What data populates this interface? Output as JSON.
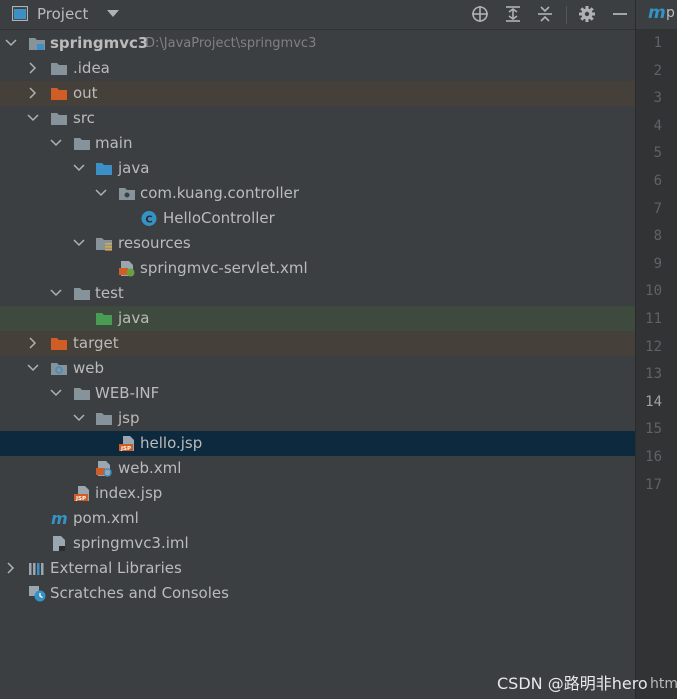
{
  "toolbar": {
    "title": "Project",
    "icons": [
      "project-view-icon",
      "dropdown-caret-icon",
      "locate-icon",
      "expand-all-icon",
      "collapse-all-icon",
      "settings-icon",
      "hide-icon"
    ]
  },
  "tree": {
    "rows": [
      {
        "label": "springmvc3",
        "path": "D:\\JavaProject\\springmvc3",
        "icon": "module-folder-icon"
      },
      {
        "label": ".idea",
        "icon": "folder-icon"
      },
      {
        "label": "out",
        "icon": "excluded-folder-icon"
      },
      {
        "label": "src",
        "icon": "folder-icon"
      },
      {
        "label": "main",
        "icon": "folder-icon"
      },
      {
        "label": "java",
        "icon": "source-folder-icon"
      },
      {
        "label": "com.kuang.controller",
        "icon": "package-icon"
      },
      {
        "label": "HelloController",
        "icon": "class-icon"
      },
      {
        "label": "resources",
        "icon": "resources-folder-icon"
      },
      {
        "label": "springmvc-servlet.xml",
        "icon": "spring-xml-icon"
      },
      {
        "label": "test",
        "icon": "folder-icon"
      },
      {
        "label": "java",
        "icon": "test-source-folder-icon"
      },
      {
        "label": "target",
        "icon": "excluded-folder-icon"
      },
      {
        "label": "web",
        "icon": "web-folder-icon"
      },
      {
        "label": "WEB-INF",
        "icon": "folder-icon"
      },
      {
        "label": "jsp",
        "icon": "folder-icon"
      },
      {
        "label": "hello.jsp",
        "icon": "jsp-file-icon"
      },
      {
        "label": "web.xml",
        "icon": "web-xml-icon"
      },
      {
        "label": "index.jsp",
        "icon": "jsp-file-icon"
      },
      {
        "label": "pom.xml",
        "icon": "maven-icon"
      },
      {
        "label": "springmvc3.iml",
        "icon": "iml-file-icon"
      },
      {
        "label": "External Libraries",
        "icon": "libraries-icon"
      },
      {
        "label": "Scratches and Consoles",
        "icon": "scratches-icon"
      }
    ]
  },
  "editor": {
    "tab_label": "p",
    "line_numbers": [
      "1",
      "2",
      "3",
      "4",
      "5",
      "6",
      "7",
      "8",
      "9",
      "10",
      "11",
      "12",
      "13",
      "14",
      "15",
      "16",
      "17"
    ],
    "active_line": "14",
    "bottom_text": "htm"
  },
  "watermark": "CSDN @路明非hero",
  "colors": {
    "panel_bg": "#3c3f41",
    "selected_row": "#0d293e",
    "excluded_row": "#45403a",
    "test_row": "#3e4a3e",
    "folder": "#87939a",
    "source_folder": "#3d8fc7",
    "excluded_folder": "#d05d25",
    "test_folder": "#499c54"
  }
}
